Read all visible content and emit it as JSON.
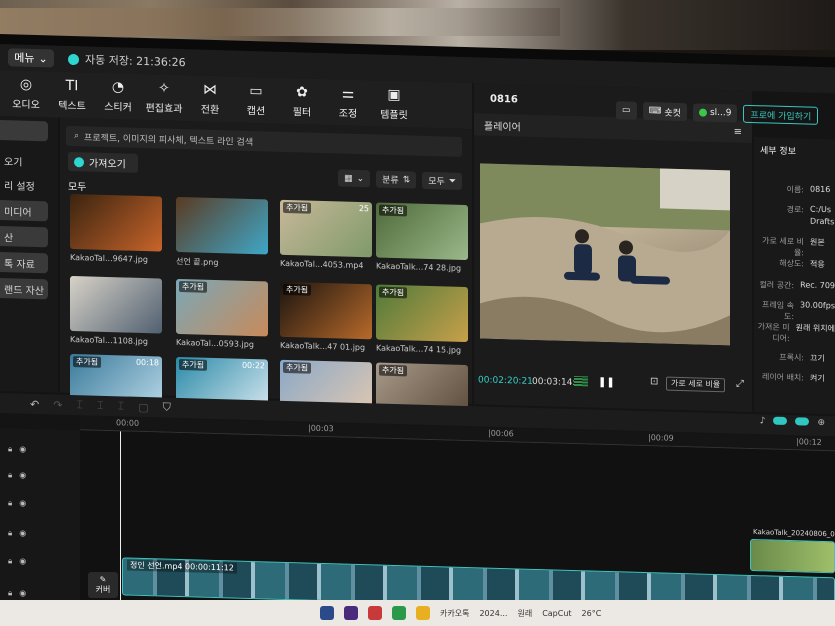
{
  "topbar": {
    "menu_label": "메뉴",
    "autosave": "자동 저장: 21:36:26"
  },
  "toolbar": [
    {
      "icon": "audio-icon",
      "glyph": "◎",
      "label": "오디오"
    },
    {
      "icon": "text-icon",
      "glyph": "TI",
      "label": "텍스트"
    },
    {
      "icon": "sticker-icon",
      "glyph": "◔",
      "label": "스티커"
    },
    {
      "icon": "effects-icon",
      "glyph": "✧",
      "label": "편집효과"
    },
    {
      "icon": "transition-icon",
      "glyph": "⋈",
      "label": "전환"
    },
    {
      "icon": "caption-icon",
      "glyph": "▭",
      "label": "캡션"
    },
    {
      "icon": "filter-icon",
      "glyph": "✿",
      "label": "필터"
    },
    {
      "icon": "adjust-icon",
      "glyph": "⚌",
      "label": "조정"
    },
    {
      "icon": "template-icon",
      "glyph": "▣",
      "label": "템플릿"
    }
  ],
  "leftnav": [
    {
      "label": "",
      "selected": true
    },
    {
      "label": "오기",
      "selected": false
    },
    {
      "label": "리 설정",
      "selected": false
    },
    {
      "label": "미디어",
      "selected": true
    },
    {
      "label": "산",
      "selected": true
    },
    {
      "label": "톡 자료",
      "selected": true
    },
    {
      "label": "랜드 자산",
      "selected": true
    }
  ],
  "media": {
    "search_placeholder": "프로젝트, 이미지의 피사체, 텍스트 라인 검색",
    "import_label": "가져오기",
    "sort_label": "분류",
    "all_label": "모두",
    "section_label": "모두",
    "items": [
      {
        "caption": "KakaoTal...9647.jpg",
        "badge": "",
        "duration": "",
        "colors": [
          "#3a2410",
          "#c8642a"
        ]
      },
      {
        "caption": "선언 끝.png",
        "badge": "",
        "duration": "",
        "colors": [
          "#5a3a22",
          "#3fa7c8"
        ]
      },
      {
        "caption": "KakaoTal...4053.mp4",
        "badge": "추가됨",
        "duration": "25",
        "colors": [
          "#c8b89a",
          "#7f9a6a"
        ]
      },
      {
        "caption": "KakaoTalk...74 28.jpg",
        "badge": "추가됨",
        "duration": "",
        "colors": [
          "#4f6a3a",
          "#9ab88a"
        ]
      },
      {
        "caption": "KakaoTal...1108.jpg",
        "badge": "",
        "duration": "",
        "colors": [
          "#d8d2c8",
          "#506070"
        ]
      },
      {
        "caption": "KakaoTal...0593.jpg",
        "badge": "추가됨",
        "duration": "",
        "colors": [
          "#7aa8b8",
          "#c88a5a"
        ]
      },
      {
        "caption": "KakaoTalk...47 01.jpg",
        "badge": "추가됨",
        "duration": "",
        "colors": [
          "#1a1410",
          "#b86a2a"
        ]
      },
      {
        "caption": "KakaoTalk...74 15.jpg",
        "badge": "추가됨",
        "duration": "",
        "colors": [
          "#4f7a3a",
          "#c8a04a"
        ]
      },
      {
        "caption": "",
        "badge": "추가됨",
        "duration": "00:18",
        "colors": [
          "#3a7a9a",
          "#b8d8e8"
        ]
      },
      {
        "caption": "",
        "badge": "추가됨",
        "duration": "00:22",
        "colors": [
          "#2a8aa8",
          "#d8e8f0"
        ]
      },
      {
        "caption": "",
        "badge": "추가됨",
        "duration": "",
        "colors": [
          "#8aa8c8",
          "#e0c8b0"
        ]
      },
      {
        "caption": "",
        "badge": "추가됨",
        "duration": "",
        "colors": [
          "#a89a8a",
          "#5a4a3a"
        ]
      }
    ]
  },
  "player": {
    "project_name": "0816",
    "header": "플레이어",
    "time_current": "00:02:20:21",
    "time_total": "00:03:14:21",
    "ratio_label": "가로 세로 비율"
  },
  "right_top": {
    "shortcut_label": "숏컷",
    "user_label": "sl...9",
    "pro_label": "프로에 가입하기"
  },
  "details": {
    "header": "세부 정보",
    "rows": [
      {
        "k": "이름:",
        "v": "0816"
      },
      {
        "k": "경로:",
        "v": "C:/Us"
      },
      {
        "k": "",
        "v": "Drafts"
      },
      {
        "k": "가로 세로 비율:",
        "v": "원본"
      },
      {
        "k": "해상도:",
        "v": "적응"
      },
      {
        "k": "컬러 공간:",
        "v": "Rec. 709"
      },
      {
        "k": "프레임 속도:",
        "v": "30.00fps"
      },
      {
        "k": "가져온 미디어:",
        "v": "원래 위치에"
      },
      {
        "k": "프록시:",
        "v": "끄기"
      },
      {
        "k": "레이어 배치:",
        "v": "켜기"
      }
    ]
  },
  "timeline": {
    "ruler": [
      "00:00",
      "|00:03",
      "|00:06",
      "|00:09",
      "|00:12"
    ],
    "main_clip_label": "정인 선언.mp4  00:00:11:12",
    "clip2_label": "KakaoTalk_20240806_00",
    "cover_label": "커버"
  },
  "taskbar": {
    "items": [
      "카카오톡",
      "2024...",
      "원래"
    ],
    "app_label": "CapCut",
    "weather": "26°C"
  }
}
